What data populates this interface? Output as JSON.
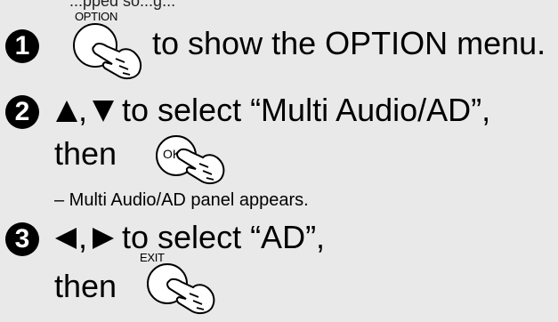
{
  "top_text": "...pped so...g...",
  "steps": [
    {
      "number": "1",
      "button_label": "OPTION",
      "text": "to show the OPTION menu."
    },
    {
      "number": "2",
      "text": "to select “Multi Audio/AD”,",
      "then": "then",
      "ok_label": "OK",
      "note": "– Multi Audio/AD panel appears."
    },
    {
      "number": "3",
      "text": "to select “AD”,",
      "then": "then",
      "button_label": "EXIT"
    }
  ],
  "punct": {
    "comma": ","
  },
  "icons": {
    "step_badge": "circled-number-icon",
    "press": "hand-press-icon",
    "up": "up-triangle-icon",
    "down": "down-triangle-icon",
    "left": "left-triangle-icon",
    "right": "right-triangle-icon"
  }
}
